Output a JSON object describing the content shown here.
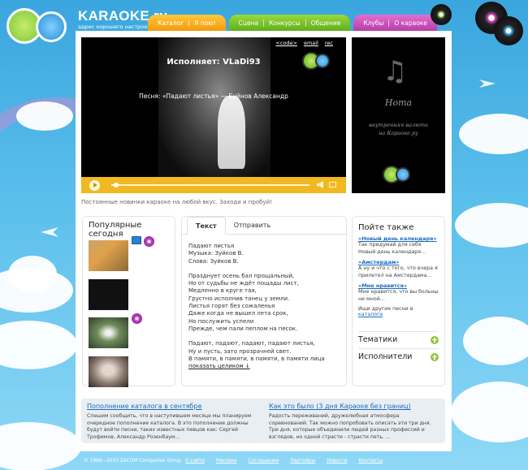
{
  "brand": {
    "name": "KARAOKE.ru",
    "tagline": "адрес хорошего настроения"
  },
  "nav": {
    "orange": [
      "Каталог",
      "Я пою!"
    ],
    "green": [
      "Сцена",
      "Конкурсы",
      "Общение"
    ],
    "pink": [
      "Клубы",
      "О караоке"
    ]
  },
  "player": {
    "artist": "Исполняет: VLaDi93",
    "song": "Песня: «Падают листья» — Буйнов Александр",
    "links": [
      "<code>",
      "email",
      "rec"
    ],
    "progress": 0.02,
    "colors": {
      "controls": "#f0b922"
    }
  },
  "nota": {
    "title": "Нота",
    "subtitle_1": "внутренняя валюта",
    "subtitle_2": "на Караоке.ру"
  },
  "tagline": "Постоянные новинки караоке на любой вкус. Заходи и пробуй!",
  "popular": {
    "title": "Популярные сегодня"
  },
  "lyrics": {
    "tabs": [
      "Текст",
      "Отправить"
    ],
    "header": [
      "Падают листья",
      "Музыка: Зуйков В.",
      "Слова: Зуйков В."
    ],
    "verse1": [
      "Празднует осень бал прощальный,",
      "Но от судьбы не ждёт пощады лист,",
      "Медленно в круге тая,",
      "Грустно исполнив танец у земли.",
      "Листья горят без сожаленья",
      "Даже когда не вышел лета срок,",
      "Но послужить успели",
      "Прежде, чем пали пеплом на песок."
    ],
    "verse2": [
      "Падают, падают, падают, падают листья,",
      "Ну и пусть, зато прозрачней свет.",
      "В памяти, в памяти, в памяти, в памяти лица"
    ],
    "show_all": "показать целиком ↓"
  },
  "also": {
    "title": "Пойте также",
    "items": [
      {
        "link": "«Новый день календаря»",
        "text": "Так придумай для себя Новый день календаря..."
      },
      {
        "link": "«Амстердам»",
        "text": "А ну и что с того, что вчера я прилетел на Амстердама..."
      },
      {
        "link": "«Мне нравится»",
        "text": "Мне нравится, что вы больны не мной..."
      }
    ],
    "search_prefix": "Ищи другие песни в ",
    "search_link": "каталоге",
    "rows": [
      "Тематики",
      "Исполнители"
    ]
  },
  "news": [
    {
      "title": "Пополнение каталога в сентябре",
      "text": "Спешим сообщить, что в наступившем месяце мы планируем очередное пополнение каталога. В это пополнение должны будут войти песни, таких известных певцов как: Сергей Трофимов, Александр Розенбаум..."
    },
    {
      "title": "Как это было (3 дня Караоке без границ)",
      "text": "Радость переживаний, дружелюбная атмосфера соревнований. Так можно попробовать описать эти три дня. Три дня, которые объединили людей разных профессий и взглядов, но одной страсти - страсти петь. ..."
    }
  ],
  "footer": {
    "copyright": "© 1998—2010 ZACOM Companies Group",
    "links": [
      "О сайте",
      "Реклама",
      "Соглашение",
      "Партнёры",
      "Новости",
      "Контакты"
    ]
  }
}
